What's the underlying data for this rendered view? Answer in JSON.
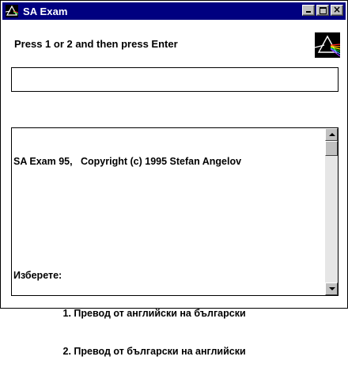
{
  "window": {
    "title": "SA Exam",
    "title_icon": "prism-icon",
    "controls": {
      "minimize_icon": "minimize-icon",
      "maximize_icon": "maximize-icon",
      "close_label": "×"
    }
  },
  "prompt": {
    "text": "Press 1 or 2 and then press Enter"
  },
  "logo": {
    "icon": "prism-logo-icon"
  },
  "input": {
    "value": "",
    "placeholder": ""
  },
  "output": {
    "lines": [
      "SA Exam 95,   Copyright (c) 1995 Stefan Angelov",
      "",
      "",
      "Изберете:",
      "                  1. Превод от английски на български",
      "                  2. Превод от български на английски"
    ]
  },
  "colors": {
    "titlebar": "#000080",
    "background": "#ffffff",
    "text": "#000000"
  }
}
